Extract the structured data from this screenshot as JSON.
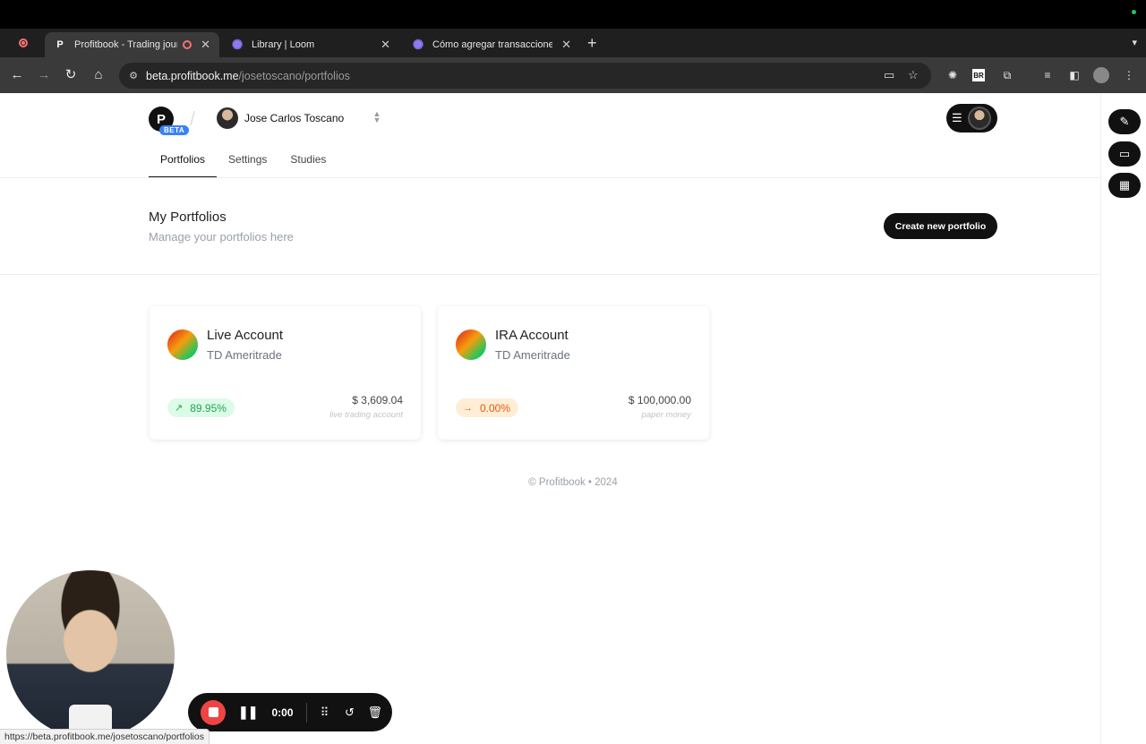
{
  "browser": {
    "tabs": [
      {
        "title": "Profitbook - Trading journ",
        "favicon": "P",
        "active": true,
        "recording": true
      },
      {
        "title": "Library | Loom",
        "favicon": "loom-icon",
        "active": false
      },
      {
        "title": "Cómo agregar transacciones",
        "favicon": "loom-icon",
        "active": false
      }
    ],
    "new_tab": "+",
    "url_host": "beta.profitbook.me",
    "url_path": "/josetoscano/portfolios"
  },
  "header": {
    "logo": "P",
    "beta": "BETA",
    "account_name": "Jose Carlos Toscano"
  },
  "nav": {
    "tabs": [
      "Portfolios",
      "Settings",
      "Studies"
    ],
    "active": "Portfolios"
  },
  "main": {
    "title": "My Portfolios",
    "subtitle": "Manage your portfolios here",
    "create_button": "Create new portfolio"
  },
  "portfolios": [
    {
      "name": "Live Account",
      "broker": "TD Ameritrade",
      "change": "89.95%",
      "direction": "up",
      "amount": "$ 3,609.04",
      "note": "live trading account"
    },
    {
      "name": "IRA Account",
      "broker": "TD Ameritrade",
      "change": "0.00%",
      "direction": "flat",
      "amount": "$ 100,000.00",
      "note": "paper money"
    }
  ],
  "footer": "© Profitbook • 2024",
  "recorder": {
    "timer": "0:00"
  },
  "status_url": "https://beta.profitbook.me/josetoscano/portfolios",
  "colors": {
    "accent": "#111111",
    "positive": "#22a355",
    "neutral": "#ea580c",
    "beta": "#3b82f6",
    "record": "#ef4444"
  }
}
